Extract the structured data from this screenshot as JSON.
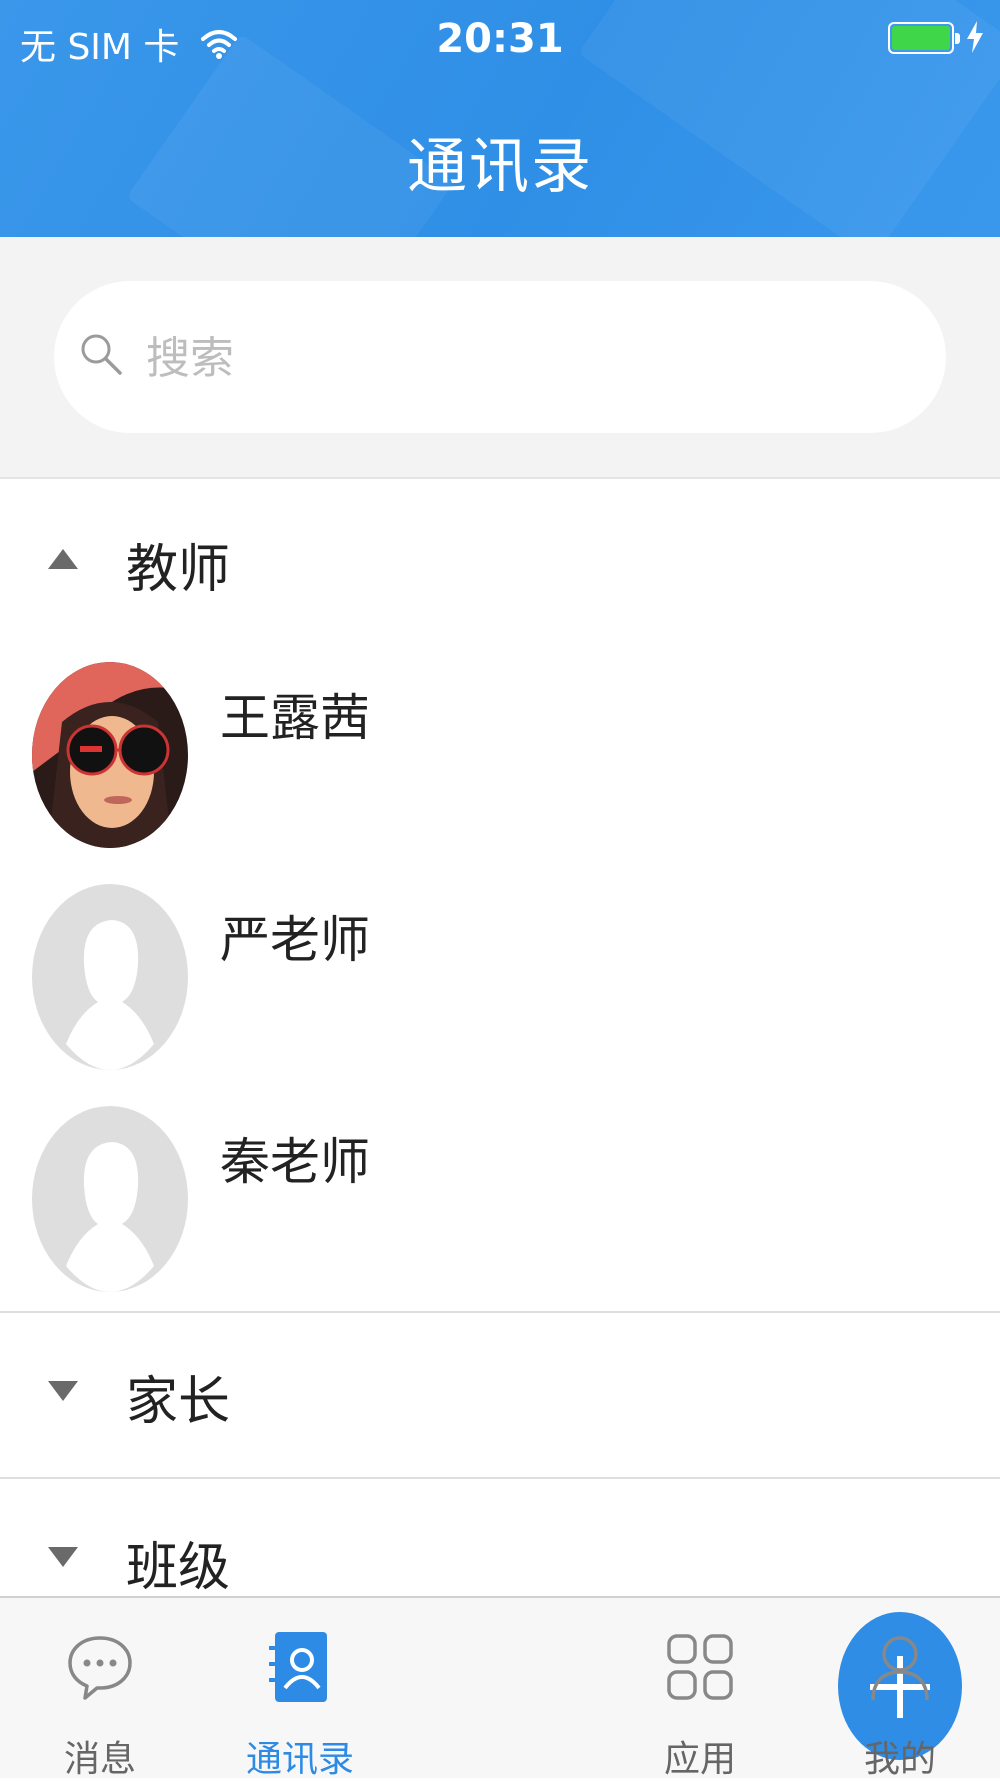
{
  "status_bar": {
    "carrier": "无 SIM 卡",
    "time": "20:31"
  },
  "header": {
    "title": "通讯录"
  },
  "search": {
    "placeholder": "搜索"
  },
  "groups": [
    {
      "label": "教师",
      "expanded": true,
      "contacts": [
        {
          "name": "王露茜"
        },
        {
          "name": "严老师"
        },
        {
          "name": "秦老师"
        }
      ]
    },
    {
      "label": "家长",
      "expanded": false
    },
    {
      "label": "班级",
      "expanded": false
    }
  ],
  "tabbar": {
    "items": [
      {
        "label": "消息",
        "icon": "chat-bubble-icon"
      },
      {
        "label": "通讯录",
        "icon": "contacts-icon",
        "active": true
      },
      {
        "label": "",
        "icon": "plus-icon"
      },
      {
        "label": "应用",
        "icon": "apps-grid-icon"
      },
      {
        "label": "我的",
        "icon": "person-icon"
      }
    ]
  },
  "colors": {
    "accent": "#2f8de6",
    "header": "#3a97ea",
    "battery": "#3fd64a"
  }
}
